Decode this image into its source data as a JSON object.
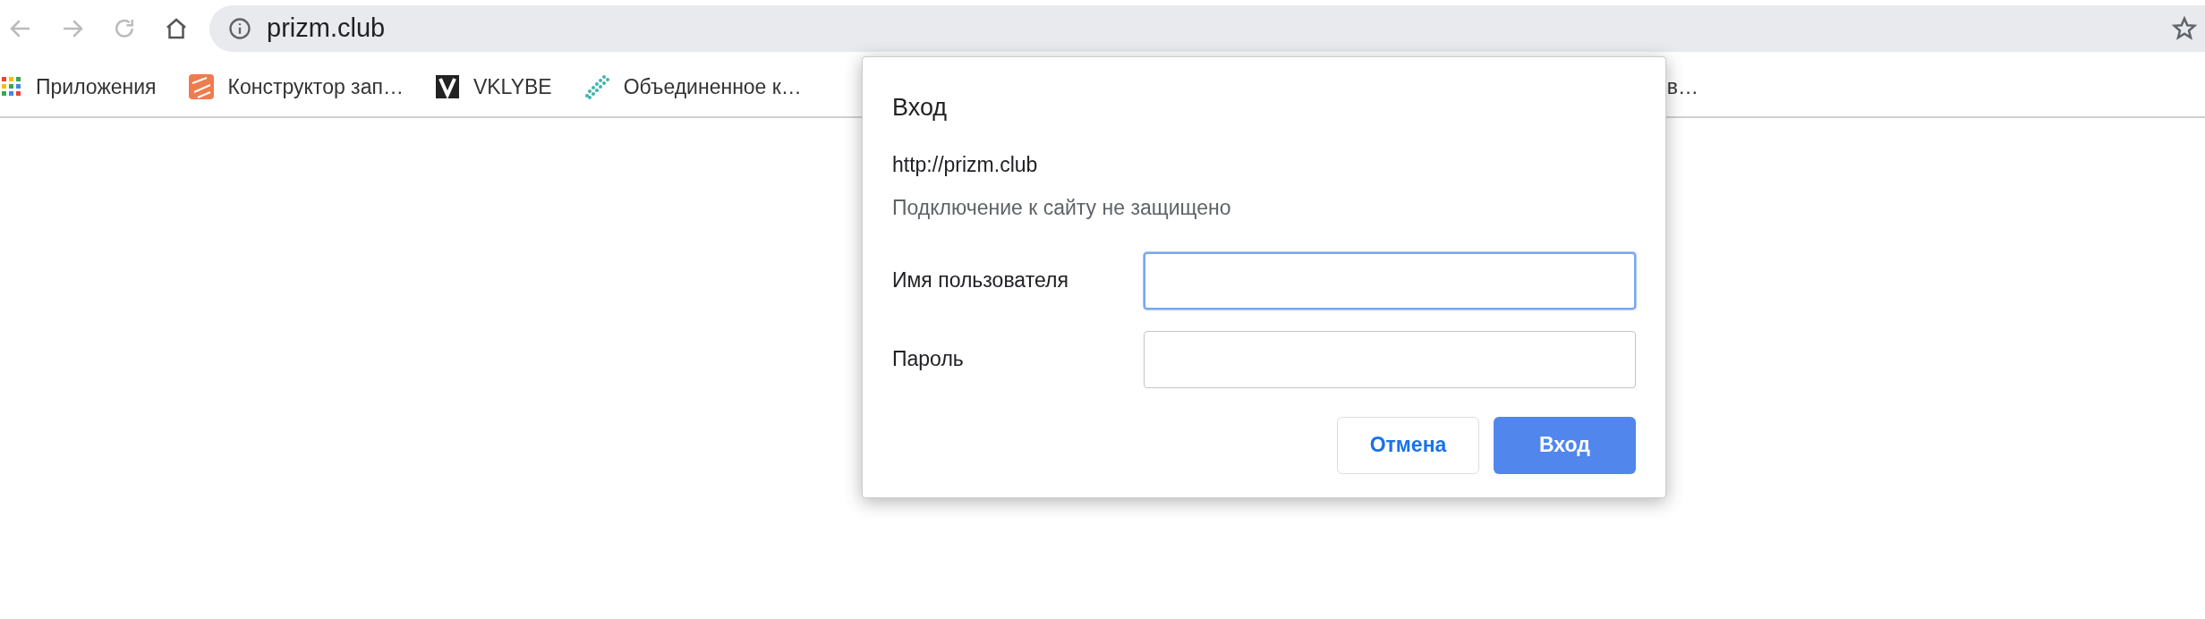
{
  "toolbar": {
    "address": "prizm.club"
  },
  "bookmarks": [
    {
      "kind": "apps",
      "label": "Приложения"
    },
    {
      "kind": "constructor",
      "label": "Конструктор зап…"
    },
    {
      "kind": "vklybe",
      "label": "VKLYBE"
    },
    {
      "kind": "dots",
      "label": "Объединенное к…"
    }
  ],
  "hidden_bookmark": {
    "label": "в…"
  },
  "dialog": {
    "title": "Вход",
    "url": "http://prizm.club",
    "note": "Подключение к сайту не защищено",
    "fields": [
      {
        "label": "Имя пользователя",
        "focused": true
      },
      {
        "label": "Пароль",
        "focused": false
      }
    ],
    "buttons": [
      {
        "kind": "secondary",
        "label": "Отмена"
      },
      {
        "kind": "primary",
        "label": "Вход"
      }
    ]
  }
}
